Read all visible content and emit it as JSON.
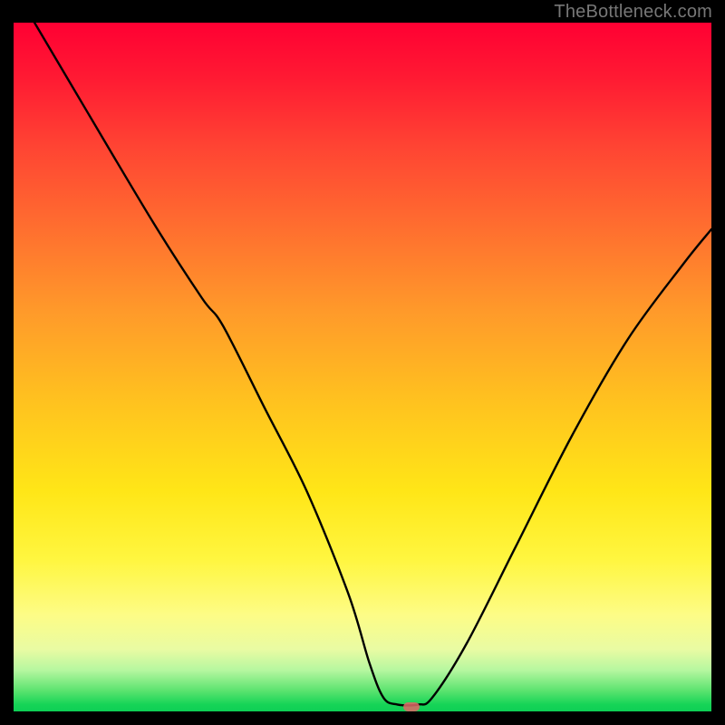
{
  "watermark": "TheBottleneck.com",
  "chart_data": {
    "type": "line",
    "title": "",
    "xlabel": "",
    "ylabel": "",
    "xlim": [
      0,
      100
    ],
    "ylim": [
      0,
      100
    ],
    "grid": false,
    "legend": false,
    "series": [
      {
        "name": "bottleneck-curve",
        "x": [
          3,
          10,
          20,
          27,
          30,
          36,
          42,
          48,
          51,
          53,
          55,
          58,
          60,
          65,
          72,
          80,
          88,
          96,
          100
        ],
        "y": [
          100,
          88,
          71,
          60,
          56,
          44,
          32,
          17,
          7,
          2,
          1,
          1,
          2,
          10,
          24,
          40,
          54,
          65,
          70
        ]
      }
    ],
    "annotations": [
      {
        "name": "optimal-marker",
        "x": 57,
        "y": 0.6
      }
    ],
    "background_gradient": {
      "direction": "vertical",
      "stops": [
        {
          "pos": 0,
          "color": "#ff0033"
        },
        {
          "pos": 30,
          "color": "#ff6f2f"
        },
        {
          "pos": 55,
          "color": "#ffc21f"
        },
        {
          "pos": 78,
          "color": "#fff640"
        },
        {
          "pos": 94,
          "color": "#b6f7a0"
        },
        {
          "pos": 100,
          "color": "#0ecf55"
        }
      ]
    }
  }
}
